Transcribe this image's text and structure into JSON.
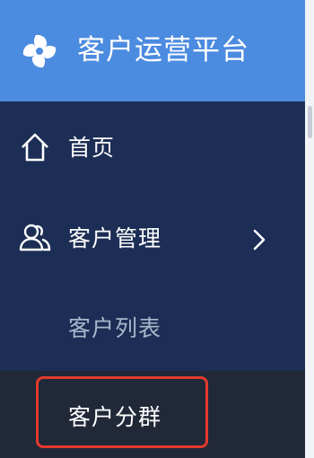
{
  "app": {
    "title": "客户运营平台",
    "logo_icon": "pinwheel-icon"
  },
  "menu": {
    "home": {
      "label": "首页",
      "icon": "home-icon"
    },
    "customer_management": {
      "label": "客户管理",
      "icon": "users-icon",
      "expand_icon": "chevron-right-icon"
    },
    "submenu": [
      {
        "label": "客户列表"
      },
      {
        "label": "客户分群"
      }
    ]
  },
  "colors": {
    "header": "#4b8be0",
    "sidebar": "#1c2e55",
    "active_item": "#212838",
    "highlight": "#e23a2d",
    "submenu_text": "#a9b7cc"
  }
}
